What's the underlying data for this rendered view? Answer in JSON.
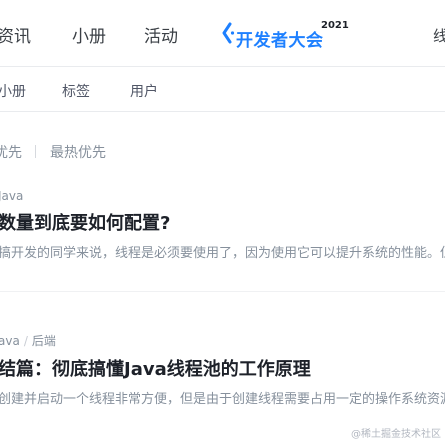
{
  "header": {
    "nav": {
      "news": "资讯",
      "book": "小册",
      "activity": "活动"
    },
    "event_logo": {
      "text": "开发者大会",
      "year": "2021"
    },
    "right_partial": "线"
  },
  "subnav": {
    "items": [
      "小册",
      "标签",
      "用户"
    ]
  },
  "sort": {
    "recommended": "优先",
    "hot": "最热优先"
  },
  "feed": [
    {
      "tags": [
        "Java"
      ],
      "title": "数量到底要如何配置?",
      "summary": "搞开发的同学来说，线程是必须要使用了，因为使用它可以提升系统的性能。但"
    },
    {
      "tags": [
        "ava",
        "后端"
      ],
      "title": "结篇：彻底搞懂Java线程池的工作原理",
      "summary": "创建并启动一个线程非常方便，但是由于创建线程需要占用一定的操作系统资源"
    }
  ],
  "watermark": "@稀土掘金技术社区",
  "colors": {
    "accent": "#1e80ff",
    "text_primary": "#1d2129",
    "text_secondary": "#86909c",
    "background": "#f4f5f5"
  }
}
